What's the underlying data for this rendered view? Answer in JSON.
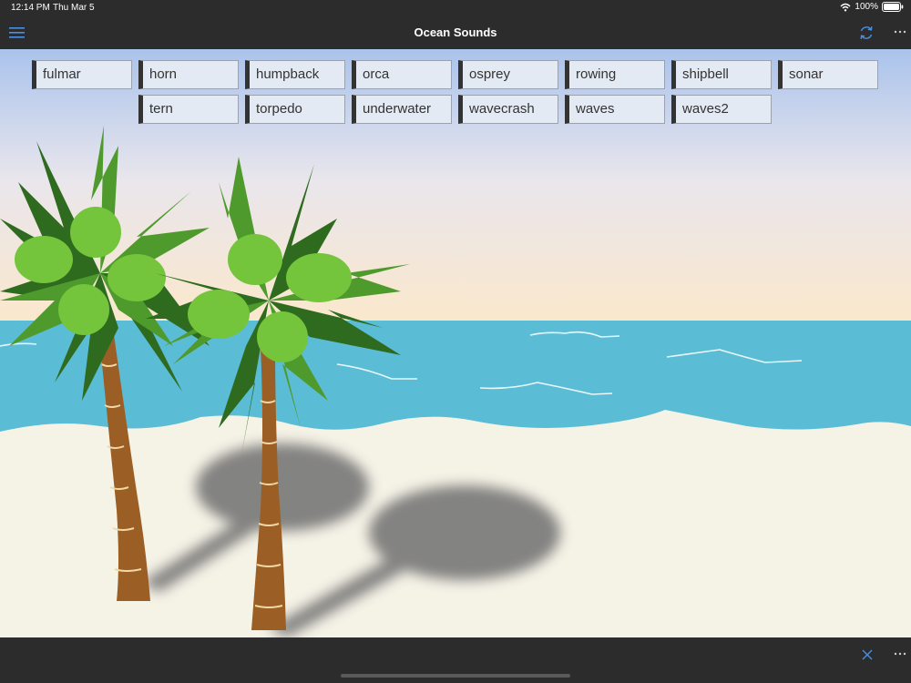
{
  "status": {
    "time": "12:14 PM",
    "date": "Thu Mar 5",
    "battery": "100%"
  },
  "header": {
    "title": "Ocean Sounds"
  },
  "sounds": {
    "row1": [
      "fulmar",
      "horn",
      "humpback",
      "orca",
      "osprey",
      "rowing",
      "shipbell",
      "sonar"
    ],
    "row2": [
      "tern",
      "torpedo",
      "underwater",
      "wavecrash",
      "waves",
      "waves2"
    ]
  },
  "icons": {
    "menu": "hamburger-menu-icon",
    "refresh": "refresh-icon",
    "more": "ellipsis-icon",
    "close": "close-icon",
    "wifi": "wifi-icon",
    "battery": "battery-icon"
  },
  "colors": {
    "sky_top": "#aac3ec",
    "sky_bottom": "#fde8c8",
    "sea": "#5bbcd5",
    "sand": "#f5f2e6",
    "button_bg": "#e4eaf4",
    "bar": "#2c2c2c"
  }
}
